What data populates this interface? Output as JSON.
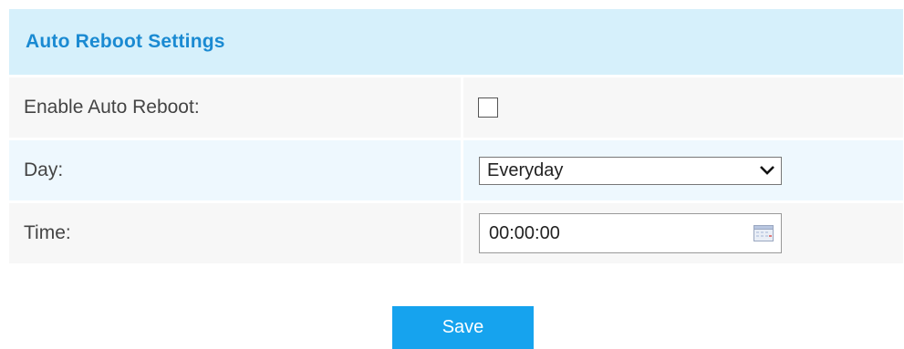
{
  "header": {
    "title": "Auto Reboot Settings"
  },
  "form": {
    "enable_auto_reboot": {
      "label": "Enable Auto Reboot:",
      "checked": false
    },
    "day": {
      "label": "Day:",
      "selected": "Everyday"
    },
    "time": {
      "label": "Time:",
      "value": "00:00:00"
    }
  },
  "actions": {
    "save_label": "Save"
  },
  "colors": {
    "header_background": "#d6f0fb",
    "header_text": "#1a8ad2",
    "row_alt_background": "#eef8fe",
    "row_plain_background": "#f7f7f7",
    "button_background": "#16a3ee",
    "button_text": "#ffffff"
  },
  "icons": {
    "dropdown": "chevron-down-icon",
    "time_picker": "calendar-icon"
  }
}
